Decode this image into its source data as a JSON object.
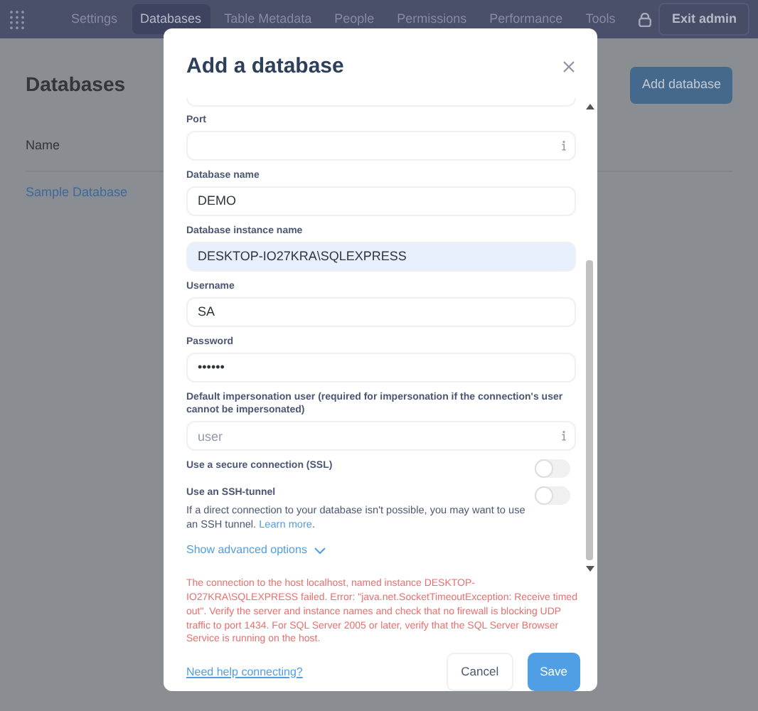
{
  "admin_nav": {
    "items": [
      {
        "label": "Settings",
        "selected": false
      },
      {
        "label": "Databases",
        "selected": true
      },
      {
        "label": "Table Metadata",
        "selected": false
      },
      {
        "label": "People",
        "selected": false
      },
      {
        "label": "Permissions",
        "selected": false
      },
      {
        "label": "Performance",
        "selected": false
      },
      {
        "label": "Tools",
        "selected": false
      }
    ],
    "exit_button": "Exit admin"
  },
  "page": {
    "title": "Databases",
    "add_button": "Add database",
    "table": {
      "columns": [
        "Name"
      ],
      "rows": [
        [
          "Sample Database"
        ]
      ]
    }
  },
  "modal": {
    "title": "Add a database",
    "fields": [
      {
        "kind": "cut"
      },
      {
        "kind": "text",
        "label": "Port",
        "info": true
      },
      {
        "kind": "text",
        "label": "Database name",
        "value": "DEMO"
      },
      {
        "kind": "text",
        "label": "Database instance name",
        "value": "DESKTOP-IO27KRA\\SQLEXPRESS",
        "autofilled": true
      },
      {
        "kind": "text",
        "label": "Username",
        "value": "SA"
      },
      {
        "kind": "text",
        "label": "Password",
        "value": "••••••"
      },
      {
        "kind": "text",
        "label": "Default impersonation user (required for impersonation if the connection's user cannot be impersonated)",
        "placeholder": "user",
        "info": true
      }
    ],
    "toggles": [
      {
        "label": "Use a secure connection (SSL)",
        "on": false
      },
      {
        "label": "Use an SSH-tunnel",
        "on": false,
        "description": "If a direct connection to your database isn't possible, you may want to use an SSH tunnel.",
        "link": "Learn more",
        "after_link": "."
      }
    ],
    "advanced_link": "Show advanced options",
    "error": "The connection to the host localhost, named instance DESKTOP-IO27KRA\\SQLEXPRESS failed. Error: \"java.net.SocketTimeoutException: Receive timed out\". Verify the server and instance names and check that no firewall is blocking UDP traffic to port 1434. For SQL Server 2005 or later, verify that the SQL Server Browser Service is running on the host.",
    "help_link": "Need help connecting?",
    "buttons": [
      {
        "label": "Cancel",
        "kind": "secondary"
      },
      {
        "label": "Save",
        "kind": "primary"
      }
    ]
  }
}
